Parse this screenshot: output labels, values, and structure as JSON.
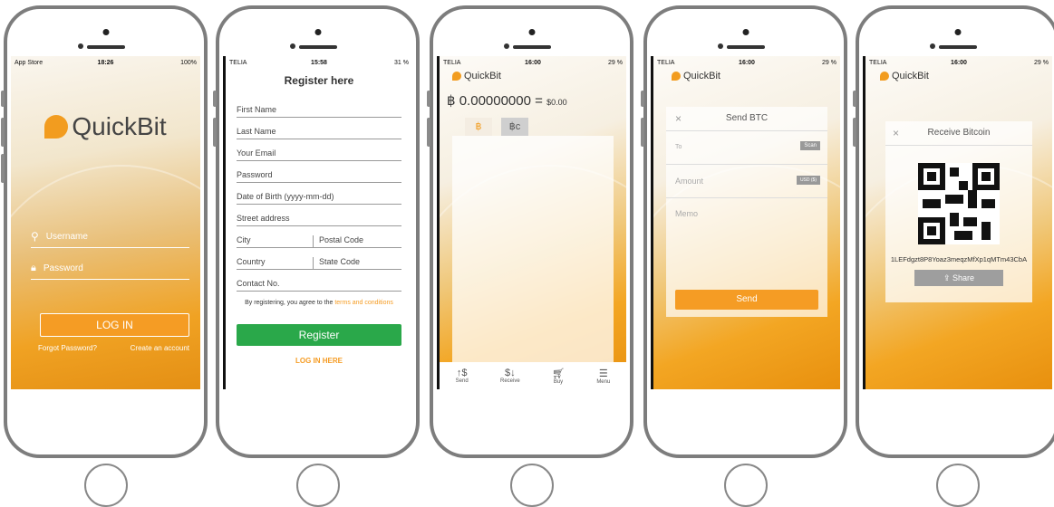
{
  "login": {
    "status": {
      "left": "App Store",
      "time": "18:26",
      "right": "100%"
    },
    "logo": "QuickBit",
    "username_placeholder": "Username",
    "password_placeholder": "Password",
    "login_button": "LOG IN",
    "forgot": "Forgot Password?",
    "create": "Create an account"
  },
  "register": {
    "status": {
      "left": "TELIA",
      "time": "15:58",
      "right": "31 %"
    },
    "title": "Register here",
    "fields": [
      "First Name",
      "Last Name",
      "Your Email",
      "Password",
      "Date of Birth (yyyy-mm-dd)",
      "Street address"
    ],
    "city": "City",
    "postal": "Postal Code",
    "country": "Country",
    "state": "State Code",
    "contact": "Contact No.",
    "agree_prefix": "By registering, you agree to the",
    "agree_link": "terms and conditions",
    "register_button": "Register",
    "login_here": "LOG IN HERE"
  },
  "wallet": {
    "status": {
      "left": "TELIA",
      "time": "16:00",
      "right": "29 %"
    },
    "logo": "QuickBit",
    "balance": "฿ 0.00000000",
    "equals": "=",
    "fiat": "$0.00",
    "tab1": "฿",
    "tab2": "฿c",
    "nav": [
      "Send",
      "Receive",
      "Buy",
      "Menu"
    ]
  },
  "send": {
    "status": {
      "left": "TELIA",
      "time": "16:00",
      "right": "29 %"
    },
    "logo": "QuickBit",
    "close": "×",
    "title": "Send BTC",
    "to": "To",
    "scan": "Scan",
    "amount": "Amount",
    "usd": "USD ($)",
    "memo": "Memo",
    "send_button": "Send"
  },
  "receive": {
    "status": {
      "left": "TELIA",
      "time": "16:00",
      "right": "29 %"
    },
    "logo": "QuickBit",
    "close": "×",
    "title": "Receive Bitcoin",
    "address": "1LEFdgzt8P8Yoaz3meqzMfXp1qMTm43CbA",
    "share": "Share"
  }
}
